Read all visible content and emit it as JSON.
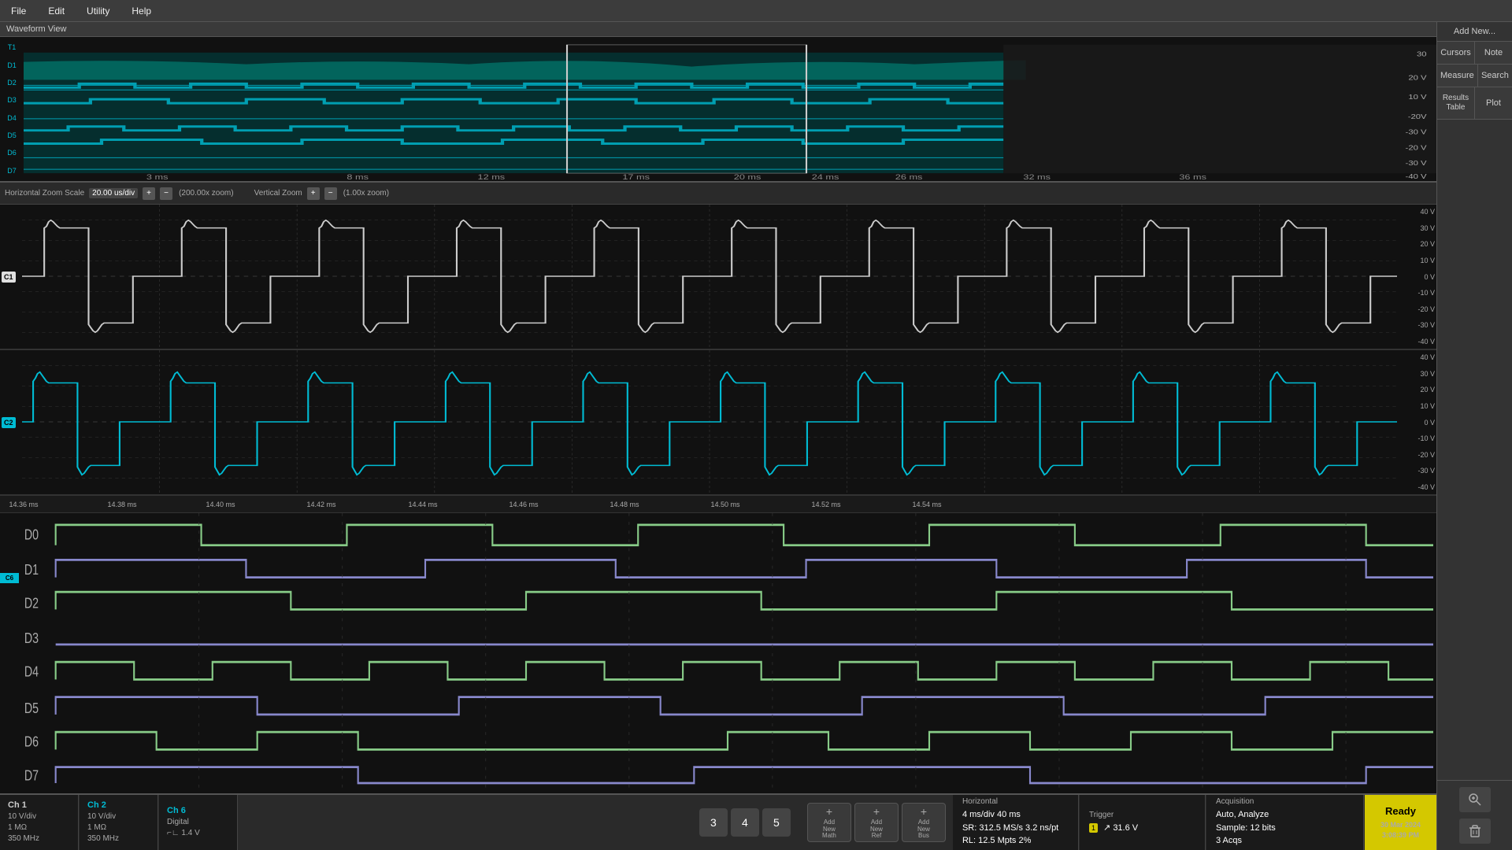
{
  "app": {
    "title": "Waveform View",
    "menu": [
      "File",
      "Edit",
      "Utility",
      "Help"
    ]
  },
  "sidebar": {
    "add_new": "Add New...",
    "buttons": [
      {
        "label": "Cursors",
        "id": "cursors"
      },
      {
        "label": "Note",
        "id": "note"
      },
      {
        "label": "Measure",
        "id": "measure"
      },
      {
        "label": "Search",
        "id": "search"
      },
      {
        "label": "Results\nTable",
        "id": "results-table"
      },
      {
        "label": "Plot",
        "id": "plot"
      }
    ]
  },
  "overview": {
    "title": "Waveform View",
    "labels": [
      "T1",
      "D1",
      "D2",
      "D3",
      "D4",
      "D5",
      "D6",
      "D7"
    ],
    "time_ticks": [
      "",
      "3 ms",
      "8 ms",
      "12 ms",
      "17 ms",
      "20 ms",
      "24 ms",
      "26 ms",
      "32 ms",
      "36 ms"
    ]
  },
  "scale_bar": {
    "h_zoom_label": "Horizontal Zoom Scale",
    "h_zoom_value": "20.00 us/div",
    "h_zoom_info": "(200.00x zoom)",
    "v_zoom_label": "Vertical Zoom",
    "v_zoom_info": "(1.00x zoom)"
  },
  "channels": {
    "c1": {
      "label": "C1",
      "voltage_ticks": [
        "40 V",
        "30 V",
        "20 V",
        "10 V",
        "0 V",
        "-10 V",
        "-20 V",
        "-30 V",
        "-40 V"
      ]
    },
    "c2": {
      "label": "C2",
      "voltage_ticks": [
        "40 V",
        "30 V",
        "20 V",
        "10 V",
        "0 V",
        "-10 V",
        "-20 V",
        "-30 V",
        "-40 V"
      ]
    }
  },
  "time_axis": {
    "ticks": [
      "14.36 ms",
      "14.38 ms",
      "14.40 ms",
      "14.42 ms",
      "14.44 ms",
      "14.46 ms",
      "14.48 ms",
      "14.50 ms",
      "14.52 ms",
      "14.54 ms"
    ]
  },
  "digital": {
    "rows": [
      "D0",
      "D1",
      "D2",
      "D3",
      "D4",
      "D5",
      "D6",
      "D7"
    ]
  },
  "bottom_bar": {
    "ch1": {
      "name": "Ch 1",
      "vdiv": "10 V/div",
      "imp": "1 MΩ",
      "bw": "350 MHz"
    },
    "ch2": {
      "name": "Ch 2",
      "vdiv": "10 V/div",
      "imp": "1 MΩ",
      "bw": "350 MHz"
    },
    "ch6": {
      "name": "Ch 6",
      "type": "Digital",
      "thres": "⌐∟ 1.4 V"
    },
    "num_buttons": [
      "3",
      "4",
      "5"
    ],
    "add_buttons": [
      "Add\nNew\nMath",
      "Add\nNew\nRef",
      "Add\nNew\nBus"
    ],
    "horizontal": {
      "title": "Horizontal",
      "val1": "4 ms/div      40 ms",
      "val2": "SR: 312.5 MS/s  3.2 ns/pt",
      "val3": "RL: 12.5 Mpts  2%"
    },
    "trigger": {
      "title": "Trigger",
      "ch": "1",
      "level": "31.6 V"
    },
    "acquisition": {
      "title": "Acquisition",
      "mode": "Auto,",
      "analyze": "Analyze",
      "sample": "Sample: 12 bits",
      "acqs": "3 Acqs"
    },
    "ready": "Ready",
    "datetime": "30 Mar 2024\n3:08:39 PM"
  },
  "status": {
    "text": "Ready"
  }
}
